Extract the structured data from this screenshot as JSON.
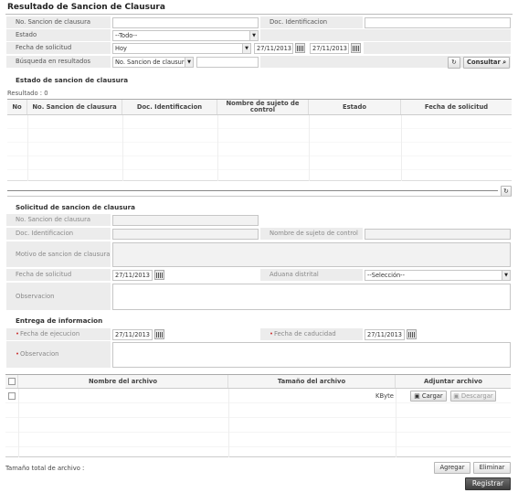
{
  "page_title": "Resultado de Sancion de Clausura",
  "search": {
    "no_sancion_label": "No. Sancion de clausura",
    "no_sancion_value": "",
    "doc_ident_label": "Doc. Identificacion",
    "doc_ident_value": "",
    "estado_label": "Estado",
    "estado_value": "--Todo--",
    "fecha_label": "Fecha de solicitud",
    "fecha_period": "Hoy",
    "fecha_desde": "27/11/2013",
    "fecha_hasta": "27/11/2013",
    "busqueda_label": "Búsqueda en resultados",
    "busqueda_field": "No. Sancion de clausur",
    "busqueda_value": "",
    "consultar_label": "Consultar"
  },
  "estado_section": {
    "title": "Estado de sancion de clausura",
    "resultado": "Resultado : 0",
    "columns": [
      "No",
      "No. Sancion de clausura",
      "Doc. Identificacion",
      "Nombre de sujeto de control",
      "Estado",
      "Fecha de solicitud"
    ]
  },
  "solicitud": {
    "title": "Solicitud de sancion de clausura",
    "no_sancion_label": "No. Sancion de clausura",
    "doc_ident_label": "Doc. Identificacion",
    "nombre_sujeto_label": "Nombre de sujeto de control",
    "motivo_label": "Motivo de sancion de clausura",
    "fecha_label": "Fecha de solicitud",
    "fecha_value": "27/11/2013",
    "aduana_label": "Aduana distrital",
    "aduana_value": "--Selección--",
    "observacion_label": "Observacion"
  },
  "entrega": {
    "title": "Entrega de informacion",
    "fecha_ejecucion_label": "Fecha de ejecucion",
    "fecha_ejecucion_value": "27/11/2013",
    "fecha_caducidad_label": "Fecha de caducidad",
    "fecha_caducidad_value": "27/11/2013",
    "observacion_label": "Observacion"
  },
  "archivos": {
    "columns": [
      "Nombre del archivo",
      "Tamaño del archivo",
      "Adjuntar archivo"
    ],
    "row_size_unit": "KByte",
    "cargar_label": "Cargar",
    "descargar_label": "Descargar",
    "total_label": "Tamaño total de archivo :",
    "agregar_label": "Agregar",
    "eliminar_label": "Eliminar"
  },
  "registrar_label": "Registrar"
}
